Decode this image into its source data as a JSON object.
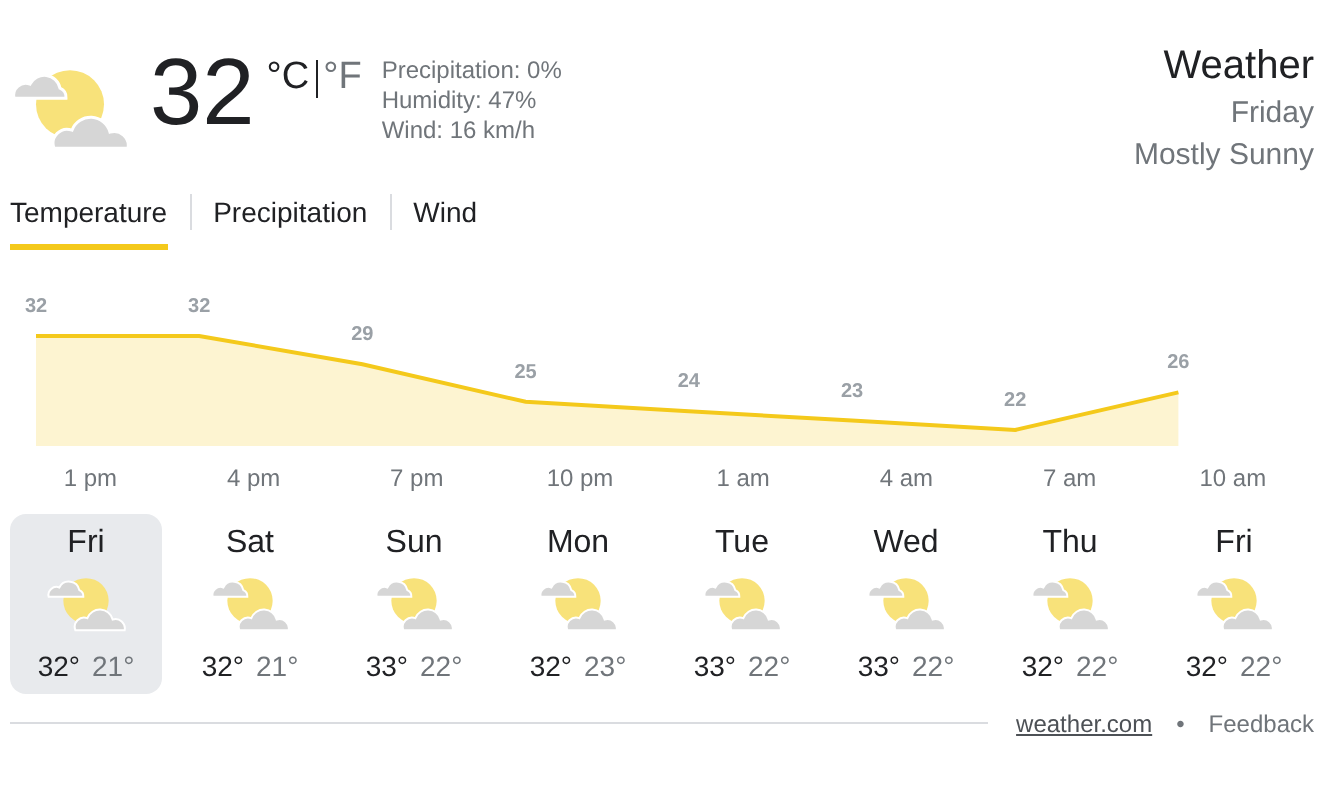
{
  "current": {
    "temperature": "32",
    "units": [
      {
        "label": "°C",
        "selected": true
      },
      {
        "label": "°F",
        "selected": false
      }
    ],
    "details": [
      "Precipitation: 0%",
      "Humidity: 47%",
      "Wind: 16 km/h"
    ]
  },
  "header": {
    "title": "Weather",
    "day": "Friday",
    "condition": "Mostly Sunny"
  },
  "tabs": [
    {
      "label": "Temperature",
      "selected": true
    },
    {
      "label": "Precipitation",
      "selected": false
    },
    {
      "label": "Wind",
      "selected": false
    }
  ],
  "chart": {
    "chart_data": {
      "type": "area",
      "categories": [
        null,
        null,
        null,
        null,
        null,
        null,
        null,
        null
      ],
      "series": [
        {
          "color": "#f4c91b",
          "values": [
            32,
            32,
            29,
            25,
            24,
            23,
            22,
            26
          ]
        }
      ],
      "data_labels": true
    },
    "time_labels": [
      "1 pm",
      "4 pm",
      "7 pm",
      "10 pm",
      "1 am",
      "4 am",
      "7 am",
      "10 am"
    ]
  },
  "days": [
    {
      "day": "Fri",
      "high": "32°",
      "low": "21°",
      "selected": true
    },
    {
      "day": "Sat",
      "high": "32°",
      "low": "21°",
      "selected": false
    },
    {
      "day": "Sun",
      "high": "33°",
      "low": "22°",
      "selected": false
    },
    {
      "day": "Mon",
      "high": "32°",
      "low": "23°",
      "selected": false
    },
    {
      "day": "Tue",
      "high": "33°",
      "low": "22°",
      "selected": false
    },
    {
      "day": "Wed",
      "high": "33°",
      "low": "22°",
      "selected": false
    },
    {
      "day": "Thu",
      "high": "32°",
      "low": "22°",
      "selected": false
    },
    {
      "day": "Fri",
      "high": "32°",
      "low": "22°",
      "selected": false
    }
  ],
  "footer": {
    "source": "weather.com",
    "separator": "•",
    "feedback": "Feedback"
  }
}
